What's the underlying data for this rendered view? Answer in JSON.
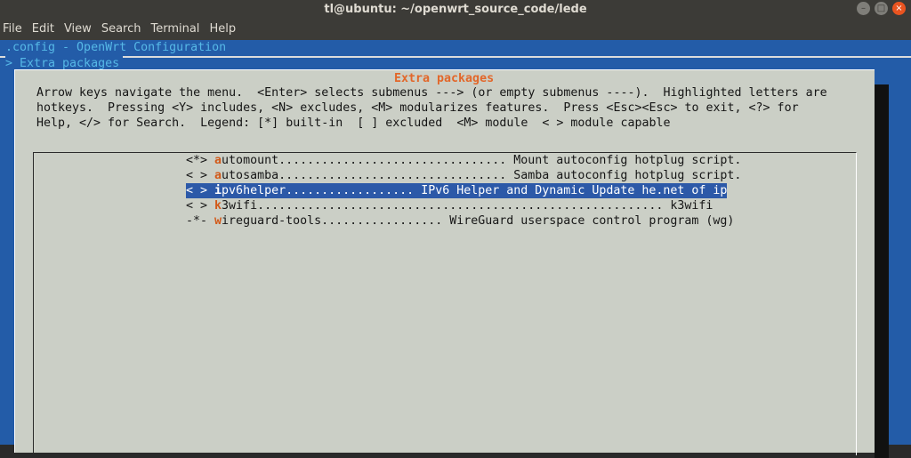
{
  "window": {
    "title": "tl@ubuntu: ~/openwrt_source_code/lede",
    "controls": {
      "minimize": "–",
      "maximize": "□",
      "close": "×"
    }
  },
  "menubar": {
    "items": [
      "File",
      "Edit",
      "View",
      "Search",
      "Terminal",
      "Help"
    ]
  },
  "breadcrumb": {
    "config": ".config - OpenWrt Configuration",
    "current": "> Extra packages"
  },
  "dialog": {
    "title": "Extra packages",
    "help": [
      "Arrow keys navigate the menu.  <Enter> selects submenus ---> (or empty submenus ----).  Highlighted letters are",
      "hotkeys.  Pressing <Y> includes, <N> excludes, <M> modularizes features.  Press <Esc><Esc> to exit, <?> for",
      "Help, </> for Search.  Legend: [*] built-in  [ ] excluded  <M> module  < > module capable"
    ],
    "items": [
      {
        "mark": "<*> ",
        "hotkey": "a",
        "rest": "utomount................................ Mount autoconfig hotplug script.",
        "selected": false
      },
      {
        "mark": "< > ",
        "hotkey": "a",
        "rest": "utosamba................................ Samba autoconfig hotplug script.",
        "selected": false
      },
      {
        "mark": "< > ",
        "hotkey": "i",
        "rest": "pv6helper.................. IPv6 Helper and Dynamic Update he.net of ip",
        "selected": true
      },
      {
        "mark": "< > ",
        "hotkey": "k",
        "rest": "3wifi......................................................... k3wifi",
        "selected": false
      },
      {
        "mark": "-*- ",
        "hotkey": "w",
        "rest": "ireguard-tools................. WireGuard userspace control program (wg)",
        "selected": false
      }
    ]
  },
  "colors": {
    "terminal_bg": "#235ca8",
    "dialog_bg": "#cbcfc6",
    "hotkey": "#d25a1a",
    "title": "#e2672a",
    "selection": "#2c59a8"
  }
}
